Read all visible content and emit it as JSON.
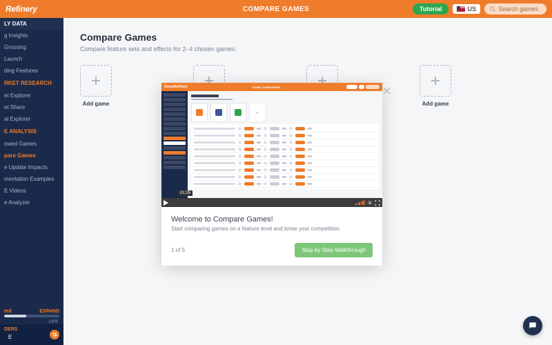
{
  "header": {
    "logo": "Refinery",
    "title": "COMPARE GAMES",
    "tutorial": "Tutorial",
    "locale": "US",
    "search_placeholder": "Search games"
  },
  "sidebar": {
    "header": "LY DATA",
    "items1": [
      "g Insights",
      "Grossing",
      "Launch",
      "ding Features"
    ],
    "section2": "RKET RESEARCH",
    "items2": [
      "et Explorer",
      "et Share",
      "al Explorer"
    ],
    "section3": "E ANALYSIS",
    "items3": [
      "owed Games",
      "pare Games",
      "e Update Impacts",
      "mentation Examples",
      "E Videos",
      "e Analyzer"
    ],
    "active_index": 1,
    "slider_left": "ted",
    "slider_right": "EXPAND",
    "slider_pct": "14%",
    "bottom_label": "DERS",
    "bottom_e": "E"
  },
  "main": {
    "title": "Compare Games",
    "subtitle": "Compare feature sets and effects for 2–4 chosen games.",
    "slot_label": "Add game"
  },
  "modal": {
    "mini_logo": "GameRefinery",
    "mini_title": "GAME COMPARISON",
    "video_time": "01:26",
    "title": "Welcome to Compare Games!",
    "subtitle": "Start comparing games on a feature level and know your competition.",
    "step": "1 of 5",
    "cta": "Step by Step Walkthrough"
  }
}
